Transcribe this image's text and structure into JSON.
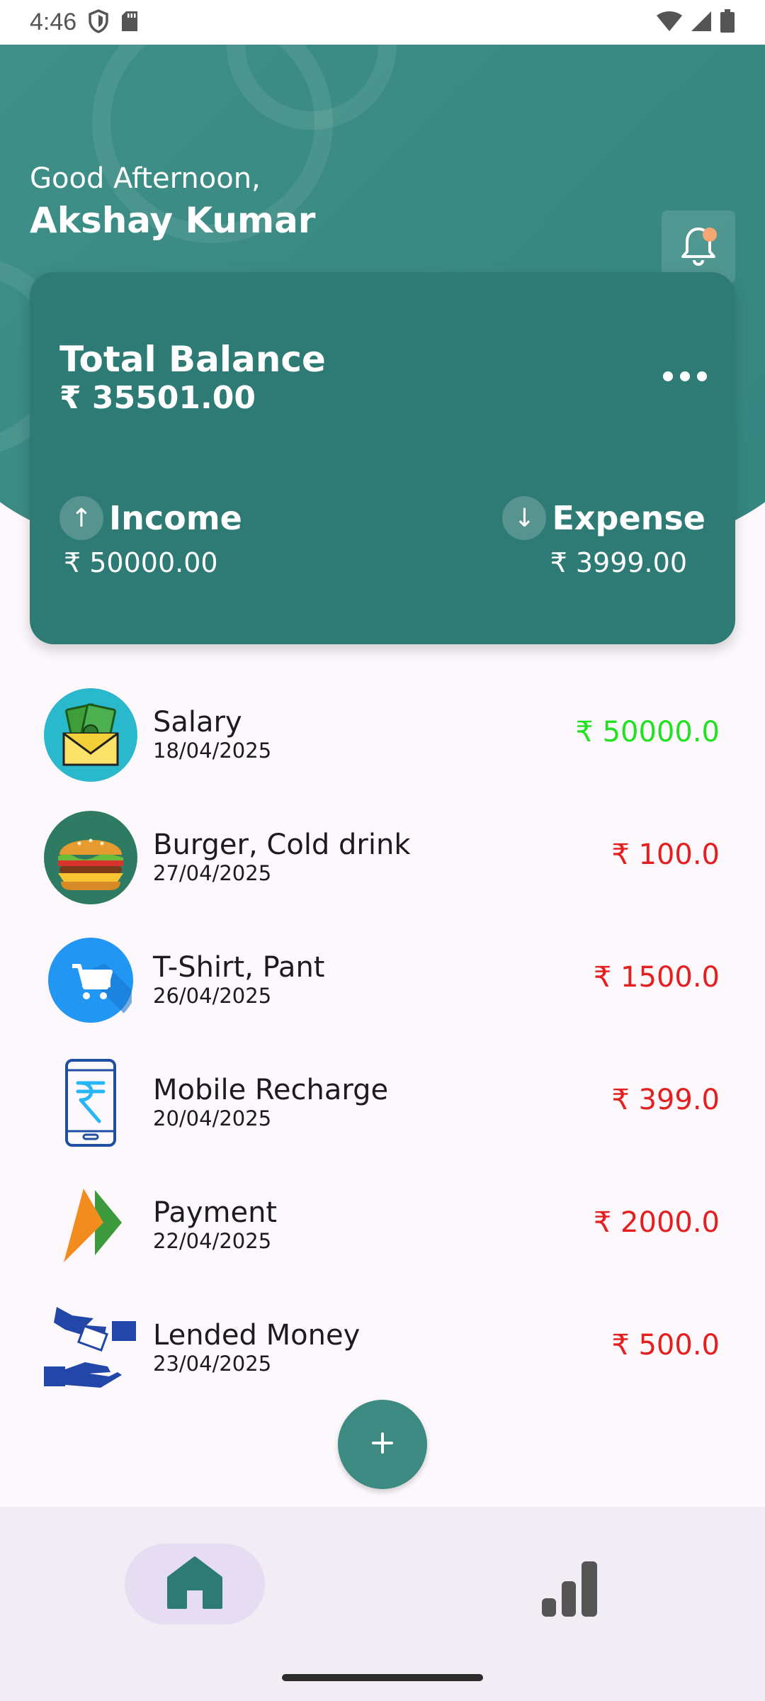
{
  "status_bar": {
    "time": "4:46",
    "icons": [
      "shield-icon",
      "sd-card-icon",
      "wifi-icon",
      "signal-icon",
      "battery-icon"
    ]
  },
  "header": {
    "greeting": "Good Afternoon,",
    "user_name": "Akshay Kumar",
    "notification_icon": "bell-icon",
    "has_notification": true
  },
  "balance_card": {
    "title": "Total Balance",
    "total": "₹ 35501.00",
    "income_label": "Income",
    "income_amount": "₹ 50000.00",
    "expense_label": "Expense",
    "expense_amount": "₹ 3999.00"
  },
  "transactions": [
    {
      "title": "Salary",
      "date": "18/04/2025",
      "amount": "₹ 50000.0",
      "type": "income",
      "icon": "salary-envelope-icon"
    },
    {
      "title": "Burger, Cold drink",
      "date": "27/04/2025",
      "amount": "₹ 100.0",
      "type": "expense",
      "icon": "burger-icon"
    },
    {
      "title": "T-Shirt, Pant",
      "date": "26/04/2025",
      "amount": "₹ 1500.0",
      "type": "expense",
      "icon": "shopping-cart-icon"
    },
    {
      "title": "Mobile Recharge",
      "date": "20/04/2025",
      "amount": "₹ 399.0",
      "type": "expense",
      "icon": "mobile-rupee-icon"
    },
    {
      "title": "Payment",
      "date": "22/04/2025",
      "amount": "₹ 2000.0",
      "type": "expense",
      "icon": "upi-payment-icon"
    },
    {
      "title": "Lended Money",
      "date": "23/04/2025",
      "amount": "₹ 500.0",
      "type": "expense",
      "icon": "hands-money-icon"
    }
  ],
  "colors": {
    "primary": "#3d8a83",
    "card": "#2e7a74",
    "income": "#22e022",
    "expense": "#e51f1f",
    "notification_dot": "#f4a772"
  },
  "fab": {
    "icon": "plus-icon"
  },
  "bottom_nav": {
    "items": [
      {
        "icon": "home-icon",
        "active": true
      },
      {
        "icon": "bar-chart-icon",
        "active": false
      }
    ]
  }
}
